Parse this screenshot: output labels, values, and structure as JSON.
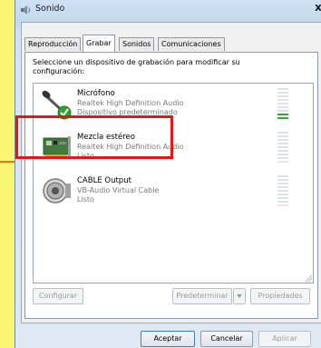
{
  "window": {
    "title": "Sonido",
    "close_glyph": "X"
  },
  "tabs": [
    "Reproducción",
    "Grabar",
    "Sonidos",
    "Comunicaciones"
  ],
  "active_tab": "Grabar",
  "instruction": "Seleccione un dispositivo de grabación para modificar su configuración:",
  "devices": [
    {
      "name": "Micrófono",
      "line1": "Realtek High Definition Audio",
      "line2": "Dispositivo predeterminado",
      "icon": "microphone-icon",
      "default": true,
      "level": 0.22
    },
    {
      "name": "Mezcla estéreo",
      "line1": "Realtek High Definition Audio",
      "line2": "Listo",
      "icon": "sound-card-icon",
      "default": false,
      "level": 0
    },
    {
      "name": "CABLE Output",
      "line1": "VB-Audio Virtual Cable",
      "line2": "Listo",
      "icon": "speaker-icon",
      "default": false,
      "level": 0
    }
  ],
  "buttons": {
    "configure": "Configurar",
    "set_default": "Predeterminar",
    "properties": "Propiedades",
    "ok": "Aceptar",
    "cancel": "Cancelar",
    "apply": "Aplicar"
  },
  "annotation": {
    "color": "#e01818",
    "pointer_color": "#e07a1a"
  }
}
